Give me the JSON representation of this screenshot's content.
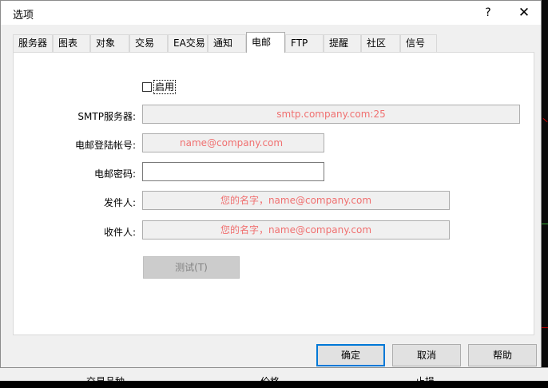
{
  "window": {
    "title": "选项",
    "help_glyph": "?",
    "close_glyph": "✕"
  },
  "tabs": [
    {
      "label": "服务器"
    },
    {
      "label": "图表"
    },
    {
      "label": "对象"
    },
    {
      "label": "交易"
    },
    {
      "label": "EA交易"
    },
    {
      "label": "通知"
    },
    {
      "label": "电邮",
      "active": true
    },
    {
      "label": "FTP"
    },
    {
      "label": "提醒"
    },
    {
      "label": "社区"
    },
    {
      "label": "信号"
    }
  ],
  "email": {
    "enable_label": "启用",
    "enable_checked": false,
    "smtp_server": {
      "label": "SMTP服务器:",
      "placeholder": "smtp.company.com:25"
    },
    "login": {
      "label": "电邮登陆帐号:",
      "placeholder": "name@company.com"
    },
    "password": {
      "label": "电邮密码:",
      "value": ""
    },
    "from": {
      "label": "发件人:",
      "placeholder": "您的名字，name@company.com"
    },
    "to": {
      "label": "收件人:",
      "placeholder": "您的名字，name@company.com"
    },
    "test_button": "测试(T)"
  },
  "footer": {
    "ok": "确定",
    "cancel": "取消",
    "help": "帮助"
  },
  "background": {
    "left_text": "交易品种",
    "mid_text": "价格",
    "right_text": "止损"
  },
  "colors": {
    "placeholder_text": "#f07070",
    "primary_border": "#0078d7"
  }
}
